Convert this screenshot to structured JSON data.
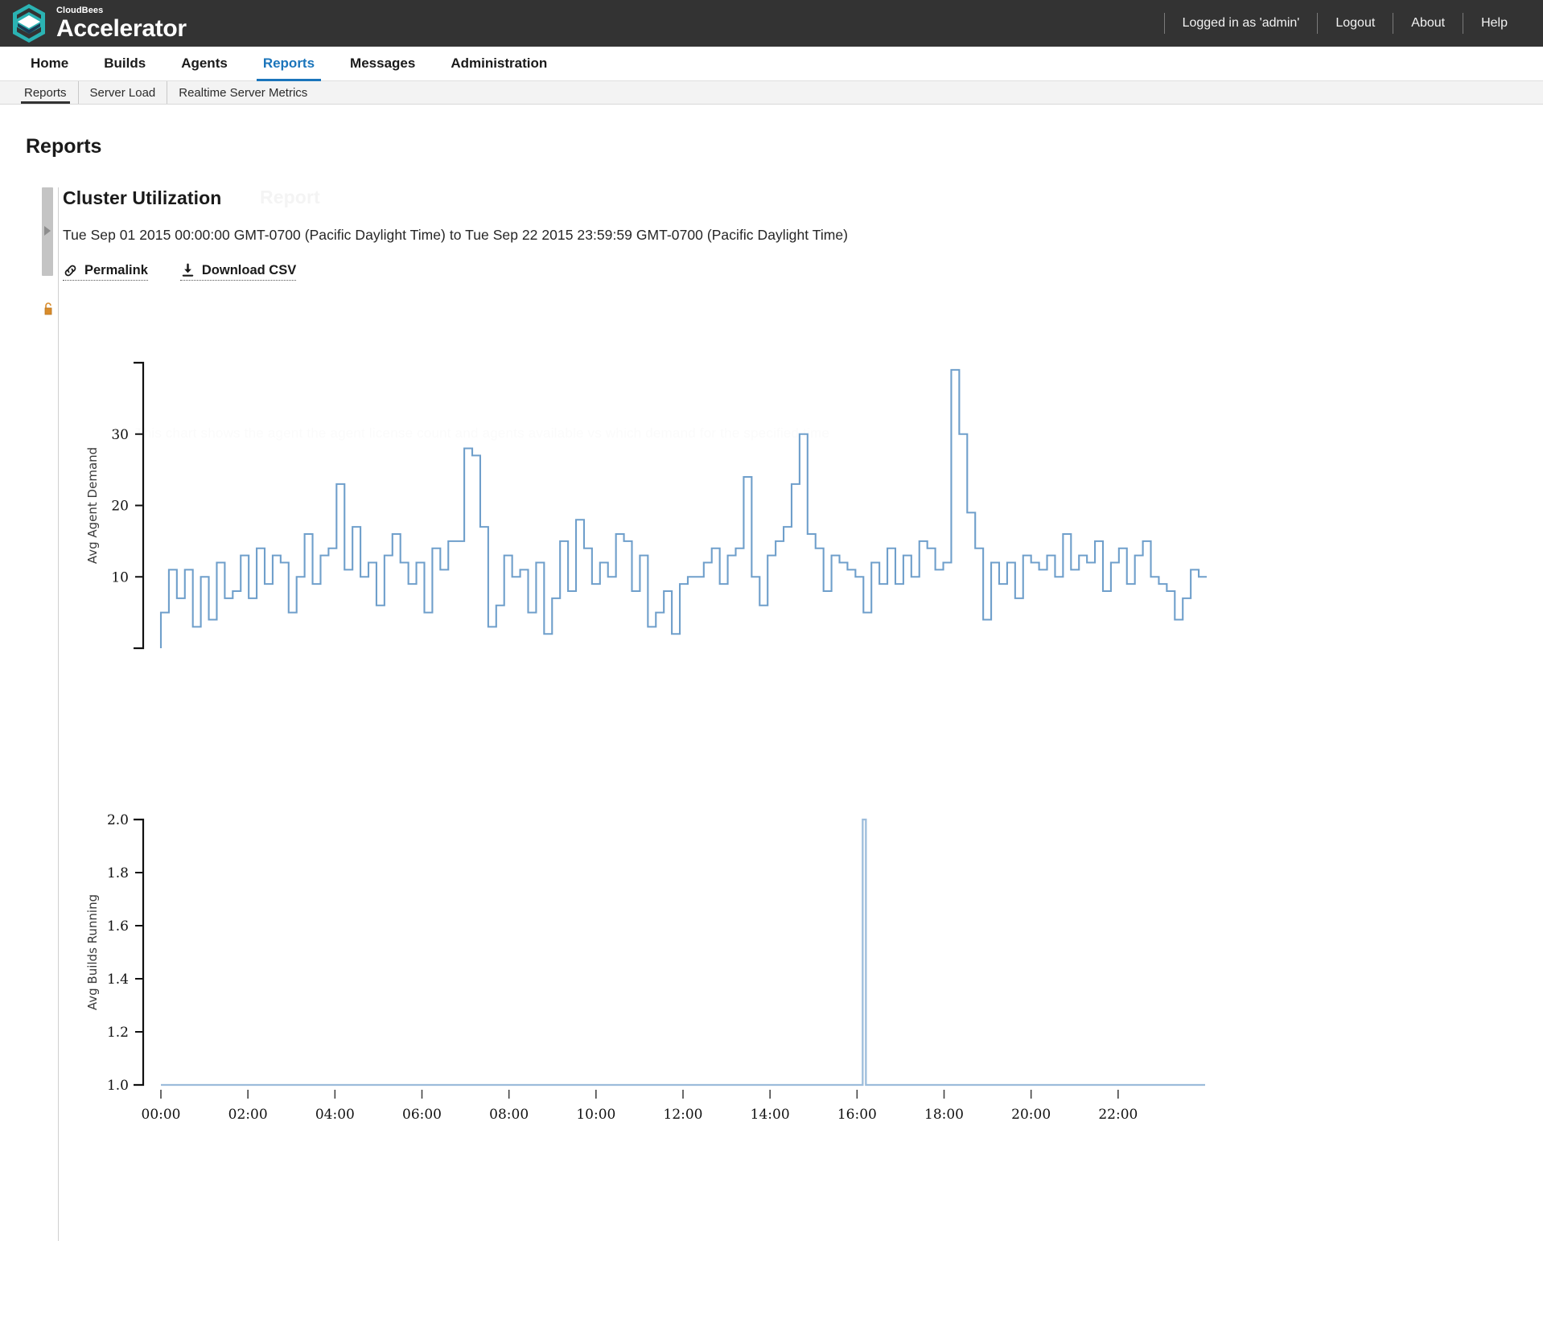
{
  "brand": {
    "small": "CloudBees",
    "name": "Accelerator",
    "logo_icon": "cloudbees-hexagon-logo",
    "accent": "#34b5b5"
  },
  "topbar": {
    "user_status": "Logged in as 'admin'",
    "logout": "Logout",
    "about": "About",
    "help": "Help",
    "background": "#333333"
  },
  "mainnav": {
    "items": [
      {
        "label": "Home",
        "active": false
      },
      {
        "label": "Builds",
        "active": false
      },
      {
        "label": "Agents",
        "active": false
      },
      {
        "label": "Reports",
        "active": true
      },
      {
        "label": "Messages",
        "active": false
      },
      {
        "label": "Administration",
        "active": false
      }
    ],
    "active_color": "#1b75bb"
  },
  "subnav": {
    "items": [
      {
        "label": "Reports",
        "active": true
      },
      {
        "label": "Server Load",
        "active": false
      },
      {
        "label": "Realtime Server Metrics",
        "active": false
      }
    ]
  },
  "page": {
    "title": "Reports"
  },
  "report": {
    "title": "Cluster Utilization",
    "ghost_title": "Report",
    "range": "Tue Sep 01 2015 00:00:00 GMT-0700 (Pacific Daylight Time) to Tue Sep 22 2015 23:59:59 GMT-0700 (Pacific Daylight Time)",
    "permalink_label": "Permalink",
    "permalink_icon": "link-icon",
    "download_label": "Download CSV",
    "download_icon": "download-icon",
    "collapse_icon": "expand-arrow-icon",
    "lock_icon": "unlock-icon",
    "ghost_description": "This chart shows the agent the agent license count and agents available vs which demand for the specified time"
  },
  "chart_data": [
    {
      "type": "line",
      "step": true,
      "title": "",
      "xlabel": "",
      "ylabel": "Avg Agent Demand",
      "ylim": [
        0,
        40
      ],
      "yticks": [
        10,
        20,
        30
      ],
      "ytick_labels": [
        "10",
        "20",
        "30"
      ],
      "xlim": [
        "00:00",
        "24:00"
      ],
      "xticks": [
        "00:00",
        "02:00",
        "04:00",
        "06:00",
        "08:00",
        "10:00",
        "12:00",
        "14:00",
        "16:00",
        "18:00",
        "20:00",
        "22:00"
      ],
      "grid": false,
      "legend": "none",
      "line_color": "#6f9fcb",
      "values": [
        5,
        11,
        7,
        11,
        3,
        10,
        4,
        12,
        7,
        8,
        13,
        7,
        14,
        9,
        13,
        12,
        5,
        10,
        16,
        9,
        13,
        14,
        23,
        11,
        17,
        10,
        12,
        6,
        13,
        16,
        12,
        9,
        12,
        5,
        14,
        11,
        15,
        15,
        28,
        27,
        17,
        3,
        6,
        13,
        10,
        11,
        5,
        12,
        2,
        7,
        15,
        8,
        18,
        14,
        9,
        12,
        10,
        16,
        15,
        8,
        13,
        3,
        5,
        8,
        2,
        9,
        10,
        10,
        12,
        14,
        9,
        13,
        14,
        24,
        10,
        6,
        13,
        15,
        17,
        23,
        30,
        16,
        14,
        8,
        13,
        12,
        11,
        10,
        5,
        12,
        9,
        14,
        9,
        13,
        10,
        15,
        14,
        11,
        12,
        39,
        30,
        19,
        14,
        4,
        12,
        9,
        12,
        7,
        13,
        12,
        11,
        13,
        10,
        16,
        11,
        13,
        12,
        15,
        8,
        12,
        14,
        9,
        13,
        15,
        10,
        9,
        8,
        4,
        7,
        11,
        10
      ]
    },
    {
      "type": "line",
      "step": false,
      "title": "",
      "xlabel": "",
      "ylabel": "Avg Builds Running",
      "ylim": [
        1.0,
        2.0
      ],
      "yticks": [
        1.0,
        1.2,
        1.4,
        1.6,
        1.8,
        2.0
      ],
      "ytick_labels": [
        "1.0",
        "1.2",
        "1.4",
        "1.6",
        "1.8",
        "2.0"
      ],
      "xticks": [
        "00:00",
        "02:00",
        "04:00",
        "06:00",
        "08:00",
        "10:00",
        "12:00",
        "14:00",
        "16:00",
        "18:00",
        "20:00",
        "22:00"
      ],
      "grid": false,
      "legend": "none",
      "line_color": "#9cbcdb",
      "baseline": 1.0,
      "spike": {
        "x": "16:10",
        "value": 2.0
      }
    }
  ]
}
